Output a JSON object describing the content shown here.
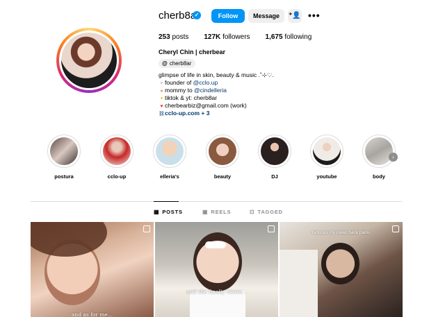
{
  "profile": {
    "username": "cherb8ar",
    "verified_icon": "verified-badge-icon",
    "follow_label": "Follow",
    "message_label": "Message",
    "posts_count": "253",
    "posts_label": "posts",
    "followers_count": "127K",
    "followers_label": "followers",
    "following_count": "1,675",
    "following_label": "following",
    "full_name": "Cheryl Chin | cherbear",
    "threads_handle": "cherb8ar",
    "bio": {
      "line1": "glimpse of life in skin, beauty & music .˚⊹♡.",
      "line2_prefix": "founder of ",
      "line2_link": "@cclo.up",
      "line3_prefix": "mommy to ",
      "line3_link": "@cindelleria",
      "line4": "tiktok & yt: cherb8ar",
      "line5": "cherbearbiz@gmail.com (work)",
      "line6_link": "cclo-up.com + 3"
    }
  },
  "highlights": [
    {
      "label": "postura"
    },
    {
      "label": "cclo-up"
    },
    {
      "label": "elleria's"
    },
    {
      "label": "beauty"
    },
    {
      "label": "DJ"
    },
    {
      "label": "youtube"
    },
    {
      "label": "body"
    }
  ],
  "tabs": [
    {
      "label": "POSTS",
      "icon": "grid-icon",
      "active": true
    },
    {
      "label": "REELS",
      "icon": "reels-icon",
      "active": false
    },
    {
      "label": "TAGGED",
      "icon": "tagged-icon",
      "active": false
    }
  ],
  "posts": [
    {
      "caption": "and as for me..."
    },
    {
      "caption": "and she finally chose..."
    },
    {
      "caption": "reduces my lower back pains"
    }
  ],
  "colors": {
    "accent": "#0095f6",
    "button_gray": "#efefef",
    "link": "#00376b"
  }
}
